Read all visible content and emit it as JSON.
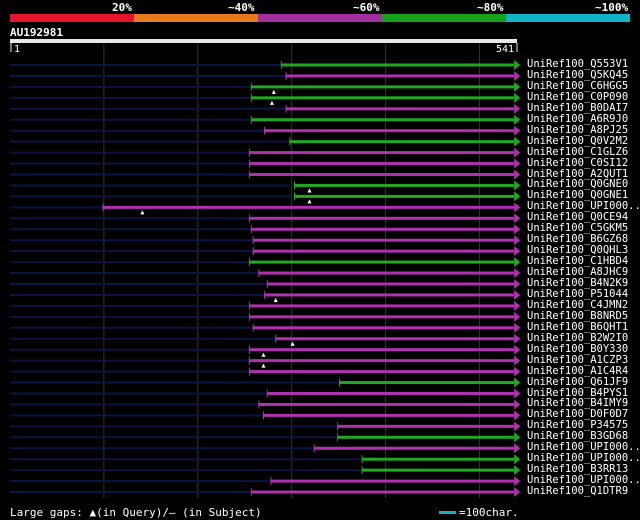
{
  "score_legend": {
    "labels": [
      "20%",
      "~40%",
      "~60%",
      "~80%",
      "~100%"
    ],
    "colors": [
      "#e8142d",
      "#e87a1e",
      "#a0309e",
      "#18a018",
      "#10b4c4"
    ]
  },
  "query": {
    "name": "AU192981",
    "start": "1",
    "end": "541",
    "length": 541
  },
  "colors": {
    "purple": "#b030b0",
    "green": "#20a820",
    "dark": "#0a1440",
    "guide": "#333333",
    "query_bar": "#e8e8e8",
    "gap": "#ffffff"
  },
  "hits": [
    {
      "id": "UniRef100_Q553V1",
      "color": "green",
      "start": 290,
      "end": 538,
      "gaps": []
    },
    {
      "id": "UniRef100_Q5KQ45",
      "color": "purple",
      "start": 295,
      "end": 538,
      "gaps": []
    },
    {
      "id": "UniRef100_C6HGG5",
      "color": "green",
      "start": 258,
      "end": 538,
      "gaps": [
        282
      ]
    },
    {
      "id": "UniRef100_C0P090",
      "color": "green",
      "start": 258,
      "end": 538,
      "gaps": [
        280
      ]
    },
    {
      "id": "UniRef100_B0DAI7",
      "color": "purple",
      "start": 295,
      "end": 538,
      "gaps": []
    },
    {
      "id": "UniRef100_A6R9J0",
      "color": "green",
      "start": 258,
      "end": 538,
      "gaps": []
    },
    {
      "id": "UniRef100_A8PJ25",
      "color": "purple",
      "start": 272,
      "end": 538,
      "gaps": []
    },
    {
      "id": "UniRef100_Q0V2M2",
      "color": "green",
      "start": 299,
      "end": 538,
      "gaps": []
    },
    {
      "id": "UniRef100_C1GLZ6",
      "color": "purple",
      "start": 256,
      "end": 538,
      "gaps": []
    },
    {
      "id": "UniRef100_C0SI12",
      "color": "purple",
      "start": 256,
      "end": 538,
      "gaps": []
    },
    {
      "id": "UniRef100_A2QUT1",
      "color": "purple",
      "start": 256,
      "end": 538,
      "gaps": []
    },
    {
      "id": "UniRef100_Q0GNE0",
      "color": "green",
      "start": 304,
      "end": 538,
      "gaps": [
        320
      ]
    },
    {
      "id": "UniRef100_Q0GNE1",
      "color": "green",
      "start": 304,
      "end": 538,
      "gaps": [
        320
      ]
    },
    {
      "id": "UniRef100_UPI000..",
      "color": "purple",
      "start": 100,
      "end": 538,
      "gaps": [
        142
      ]
    },
    {
      "id": "UniRef100_Q0CE94",
      "color": "purple",
      "start": 256,
      "end": 538,
      "gaps": []
    },
    {
      "id": "UniRef100_C5GKM5",
      "color": "purple",
      "start": 258,
      "end": 538,
      "gaps": []
    },
    {
      "id": "UniRef100_B6GZ68",
      "color": "purple",
      "start": 260,
      "end": 538,
      "gaps": []
    },
    {
      "id": "UniRef100_Q0QHL3",
      "color": "purple",
      "start": 260,
      "end": 538,
      "gaps": []
    },
    {
      "id": "UniRef100_C1HBD4",
      "color": "green",
      "start": 256,
      "end": 538,
      "gaps": []
    },
    {
      "id": "UniRef100_A8JHC9",
      "color": "purple",
      "start": 266,
      "end": 538,
      "gaps": []
    },
    {
      "id": "UniRef100_B4N2K9",
      "color": "purple",
      "start": 275,
      "end": 538,
      "gaps": []
    },
    {
      "id": "UniRef100_P51044",
      "color": "purple",
      "start": 272,
      "end": 538,
      "gaps": [
        284
      ]
    },
    {
      "id": "UniRef100_C4JMN2",
      "color": "purple",
      "start": 256,
      "end": 538,
      "gaps": []
    },
    {
      "id": "UniRef100_B8NRD5",
      "color": "purple",
      "start": 256,
      "end": 538,
      "gaps": []
    },
    {
      "id": "UniRef100_B6QHT1",
      "color": "purple",
      "start": 260,
      "end": 538,
      "gaps": []
    },
    {
      "id": "UniRef100_B2W2I0",
      "color": "purple",
      "start": 284,
      "end": 538,
      "gaps": [
        302
      ]
    },
    {
      "id": "UniRef100_B0Y330",
      "color": "purple",
      "start": 256,
      "end": 538,
      "gaps": [
        271
      ]
    },
    {
      "id": "UniRef100_A1CZP3",
      "color": "purple",
      "start": 256,
      "end": 538,
      "gaps": [
        271
      ]
    },
    {
      "id": "UniRef100_A1C4R4",
      "color": "purple",
      "start": 256,
      "end": 538,
      "gaps": []
    },
    {
      "id": "UniRef100_Q61JF9",
      "color": "green",
      "start": 352,
      "end": 538,
      "gaps": []
    },
    {
      "id": "UniRef100_B4PYS1",
      "color": "purple",
      "start": 275,
      "end": 538,
      "gaps": []
    },
    {
      "id": "UniRef100_B4IMY9",
      "color": "purple",
      "start": 266,
      "end": 538,
      "gaps": []
    },
    {
      "id": "UniRef100_D0F0D7",
      "color": "purple",
      "start": 271,
      "end": 538,
      "gaps": []
    },
    {
      "id": "UniRef100_P34575",
      "color": "purple",
      "start": 350,
      "end": 538,
      "gaps": []
    },
    {
      "id": "UniRef100_B3GD68",
      "color": "green",
      "start": 350,
      "end": 538,
      "gaps": []
    },
    {
      "id": "UniRef100_UPI000..",
      "color": "purple",
      "start": 325,
      "end": 538,
      "gaps": []
    },
    {
      "id": "UniRef100_UPI000..",
      "color": "green",
      "start": 376,
      "end": 538,
      "gaps": []
    },
    {
      "id": "UniRef100_B3RR13",
      "color": "green",
      "start": 376,
      "end": 538,
      "gaps": []
    },
    {
      "id": "UniRef100_UPI000..",
      "color": "purple",
      "start": 279,
      "end": 538,
      "gaps": []
    },
    {
      "id": "UniRef100_Q1DTR9",
      "color": "purple",
      "start": 258,
      "end": 538,
      "gaps": []
    }
  ],
  "footer": {
    "legend_text": "Large gaps: ▲(in Query)/– (in Subject)",
    "scale_text": "=100char.",
    "scale_chars": 100,
    "scale_color": "#10b4c4"
  }
}
